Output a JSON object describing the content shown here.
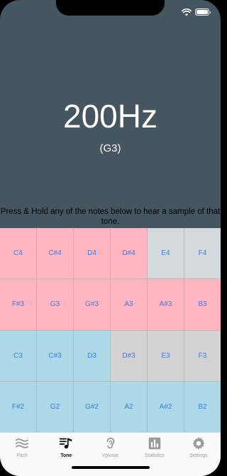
{
  "pitch": {
    "frequency": "200Hz",
    "note": "(G3)"
  },
  "instructions": "Press & Hold any of the notes below to hear a sample of that tone.",
  "colors": {
    "pink": "#ffb6c1",
    "blue": "#add8e6",
    "gray": "#d3d3d3",
    "grayBlue": "#d4d9dd",
    "keyText": "#3a7be0",
    "background": "#465661"
  },
  "keys": [
    [
      {
        "label": "C4",
        "color": "pink"
      },
      {
        "label": "C#4",
        "color": "pink"
      },
      {
        "label": "D4",
        "color": "pink"
      },
      {
        "label": "D#4",
        "color": "pink"
      },
      {
        "label": "E4",
        "color": "grayBlue"
      },
      {
        "label": "F4",
        "color": "grayBlue"
      }
    ],
    [
      {
        "label": "F#3",
        "color": "pink"
      },
      {
        "label": "G3",
        "color": "pink"
      },
      {
        "label": "G#3",
        "color": "pink"
      },
      {
        "label": "A3",
        "color": "pink"
      },
      {
        "label": "A#3",
        "color": "pink"
      },
      {
        "label": "B3",
        "color": "pink"
      }
    ],
    [
      {
        "label": "C3",
        "color": "blue"
      },
      {
        "label": "C#3",
        "color": "blue"
      },
      {
        "label": "D3",
        "color": "blue"
      },
      {
        "label": "D#3",
        "color": "gray"
      },
      {
        "label": "E3",
        "color": "gray"
      },
      {
        "label": "F3",
        "color": "gray"
      }
    ],
    [
      {
        "label": "F#2",
        "color": "blue"
      },
      {
        "label": "G2",
        "color": "blue"
      },
      {
        "label": "G#2",
        "color": "blue"
      },
      {
        "label": "A2",
        "color": "blue"
      },
      {
        "label": "A#2",
        "color": "blue"
      },
      {
        "label": "B2",
        "color": "blue"
      }
    ]
  ],
  "tabs": [
    {
      "label": "Pitch",
      "icon": "waves-icon",
      "active": false
    },
    {
      "label": "Tone",
      "icon": "music-note-icon",
      "active": true
    },
    {
      "label": "Volume",
      "icon": "ear-icon",
      "active": false
    },
    {
      "label": "Statistics",
      "icon": "bar-chart-icon",
      "active": false
    },
    {
      "label": "Settings",
      "icon": "gear-icon",
      "active": false
    }
  ]
}
